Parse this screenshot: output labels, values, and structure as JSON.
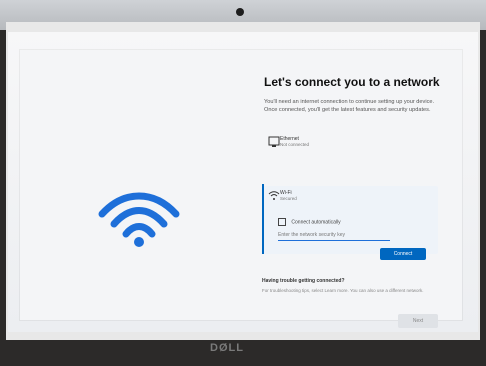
{
  "setup": {
    "title": "Let's connect you to a network",
    "description": "You'll need an internet connection to continue setting up your device. Once connected, you'll get the latest features and security updates.",
    "networks": [
      {
        "name": "Ethernet",
        "status": "Not connected"
      },
      {
        "name": "Wi-Fi",
        "status": "Secured"
      }
    ],
    "auto_connect_label": "Connect automatically",
    "password_placeholder": "Enter the network security key",
    "connect_button": "Connect",
    "help_heading": "Having trouble getting connected?",
    "help_text": "For troubleshooting tips, select Learn more. You can also use a different network.",
    "next_button": "Next"
  },
  "device": {
    "brand_logo_text": "DØLL"
  },
  "icons": {
    "wifi": "wifi-icon",
    "ethernet": "ethernet-icon",
    "wifi_network": "wifi-network-icon",
    "checkbox": "checkbox-icon"
  },
  "colors": {
    "accent": "#0067c0"
  }
}
